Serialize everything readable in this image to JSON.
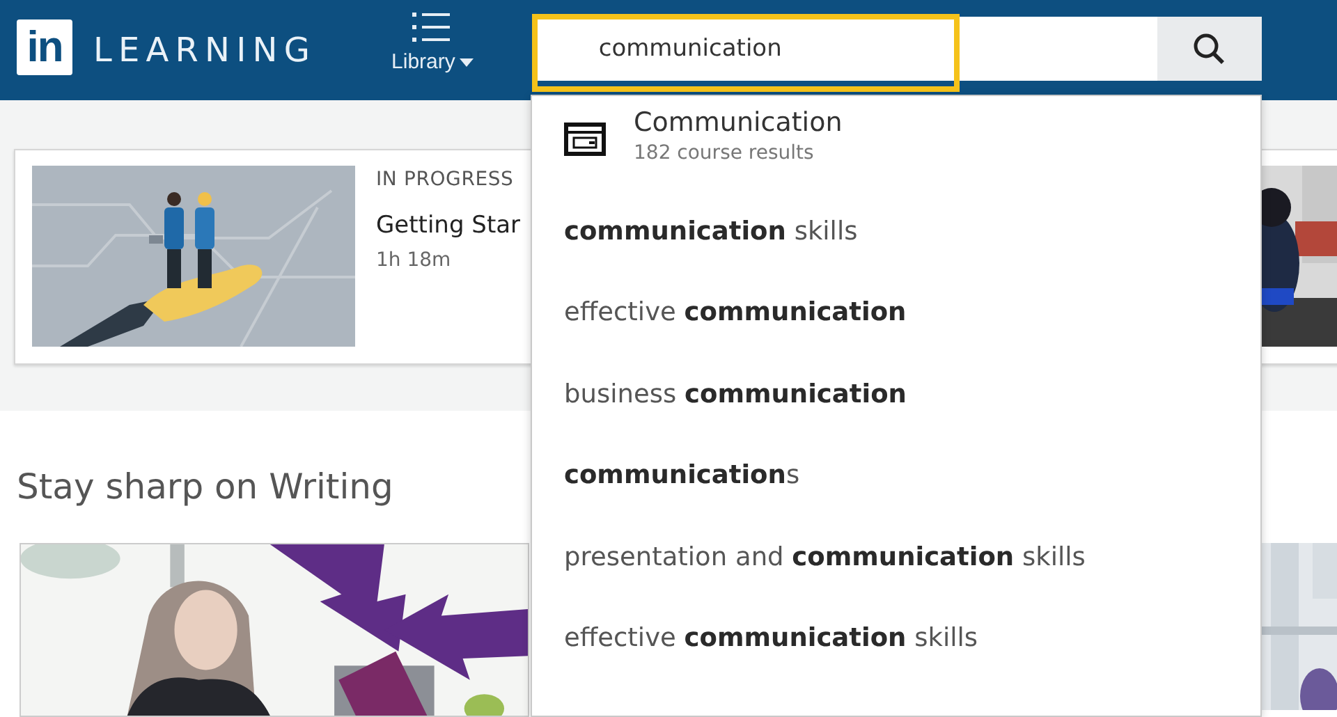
{
  "header": {
    "logo_mark": "in",
    "logo_text": "LEARNING",
    "library_label": "Library"
  },
  "search": {
    "value": "communication",
    "highlighted": true
  },
  "dropdown": {
    "top_result": {
      "title": "Communication",
      "subtitle": "182 course results"
    },
    "suggestions": [
      "**communication** skills",
      "effective **communication**",
      "business **communication**",
      "**communication**s",
      "presentation and **communication** skills",
      "effective **communication** skills"
    ]
  },
  "continue_cards": [
    {
      "kind": "course",
      "status": "IN PROGRESS",
      "title": "Getting Star",
      "duration": "1h 18m"
    },
    {
      "kind": "picture"
    }
  ],
  "section": {
    "title": "Stay sharp on Writing",
    "cards": [
      {
        "kind": "picture"
      },
      {
        "kind": "picture"
      }
    ]
  }
}
